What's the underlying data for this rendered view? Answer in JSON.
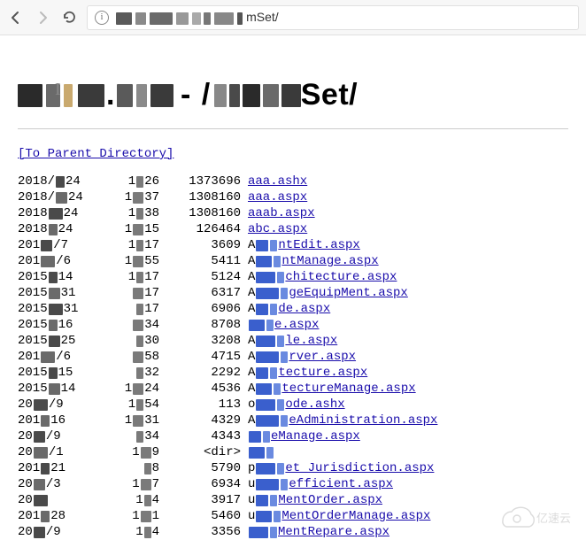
{
  "address_bar": {
    "url_suffix": "mSet/"
  },
  "heading": {
    "suffix": "Set/"
  },
  "parent_link": "[To Parent Directory]",
  "listing": [
    {
      "date_pre": "2018/",
      "date_post": "24",
      "time_pre": "1",
      "time_post": "26",
      "size": "1373696",
      "name": "aaa.ashx",
      "plain": true
    },
    {
      "date_pre": "2018/",
      "date_post": "24",
      "time_pre": "1",
      "time_post": "37",
      "size": "1308160",
      "name": "aaa.aspx",
      "plain": true
    },
    {
      "date_pre": "2018",
      "date_post": "24",
      "time_pre": "1",
      "time_post": "38",
      "size": "1308160",
      "name": "aaab.aspx",
      "plain": true
    },
    {
      "date_pre": "2018",
      "date_post": "24",
      "time_pre": "1",
      "time_post": "15",
      "size": "126464",
      "name": "abc.aspx",
      "plain": true
    },
    {
      "date_pre": "201",
      "date_post": "/7",
      "time_pre": "1",
      "time_post": "17",
      "size": "3609",
      "pre": "A",
      "name": "ntEdit.aspx"
    },
    {
      "date_pre": "201",
      "date_post": "/6",
      "time_pre": "1",
      "time_post": "55",
      "size": "5411",
      "pre": "A",
      "name": "ntManage.aspx"
    },
    {
      "date_pre": "2015",
      "date_post": "14",
      "time_pre": "1",
      "time_post": "17",
      "size": "5124",
      "pre": "A",
      "name": "chitecture.aspx"
    },
    {
      "date_pre": "2015",
      "date_post": "31",
      "time_pre": "",
      "time_post": "17",
      "size": "6317",
      "pre": "A",
      "name": "geEquipMent.aspx"
    },
    {
      "date_pre": "2015",
      "date_post": "31",
      "time_pre": "",
      "time_post": "17",
      "size": "6906",
      "pre": "A",
      "name": "de.aspx"
    },
    {
      "date_pre": "2015",
      "date_post": "16",
      "time_pre": "",
      "time_post": "34",
      "size": "8708",
      "pre": "",
      "name": "e.aspx"
    },
    {
      "date_pre": "2015",
      "date_post": "25",
      "time_pre": "",
      "time_post": "30",
      "size": "3208",
      "pre": "A",
      "name": "le.aspx"
    },
    {
      "date_pre": "201",
      "date_post": "/6",
      "time_pre": "",
      "time_post": "58",
      "size": "4715",
      "pre": "A",
      "name": "rver.aspx"
    },
    {
      "date_pre": "2015",
      "date_post": "15",
      "time_pre": "",
      "time_post": "32",
      "size": "2292",
      "pre": "A",
      "name": "tecture.aspx"
    },
    {
      "date_pre": "2015",
      "date_post": "14",
      "time_pre": "1",
      "time_post": "24",
      "size": "4536",
      "pre": "A",
      "name": "tectureManage.aspx"
    },
    {
      "date_pre": "20",
      "date_post": "/9",
      "time_pre": "1",
      "time_post": "54",
      "size": "113",
      "pre": "o",
      "name": "ode.ashx"
    },
    {
      "date_pre": "201",
      "date_post": "16",
      "time_pre": "1",
      "time_post": "31",
      "size": "4329",
      "pre": "A",
      "name": "eAdministration.aspx"
    },
    {
      "date_pre": "20",
      "date_post": "/9",
      "time_pre": "",
      "time_post": "34",
      "size": "4343",
      "pre": "",
      "name": "eManage.aspx"
    },
    {
      "date_pre": "20",
      "date_post": "/1",
      "time_pre": "1",
      "time_post": "9",
      "size": "<dir>",
      "pre": "",
      "name": "",
      "nolink": true
    },
    {
      "date_pre": "201",
      "date_post": "21",
      "time_pre": "",
      "time_post": "8",
      "size": "5790",
      "pre": "p",
      "name": "et_Jurisdiction.aspx"
    },
    {
      "date_pre": "20",
      "date_post": "/3",
      "time_pre": "1",
      "time_post": "7",
      "size": "6934",
      "pre": "u",
      "name": "efficient.aspx"
    },
    {
      "date_pre": "20",
      "date_post": "",
      "time_pre": "1",
      "time_post": "4",
      "size": "3917",
      "pre": "u",
      "name": "MentOrder.aspx"
    },
    {
      "date_pre": "201",
      "date_post": "28",
      "time_pre": "1",
      "time_post": "1",
      "size": "5460",
      "pre": "u",
      "name": "MentOrderManage.aspx"
    },
    {
      "date_pre": "20",
      "date_post": "/9",
      "time_pre": "1",
      "time_post": "4",
      "size": "3356",
      "pre": "",
      "name": "MentRepare.aspx"
    }
  ],
  "watermark": "亿速云"
}
